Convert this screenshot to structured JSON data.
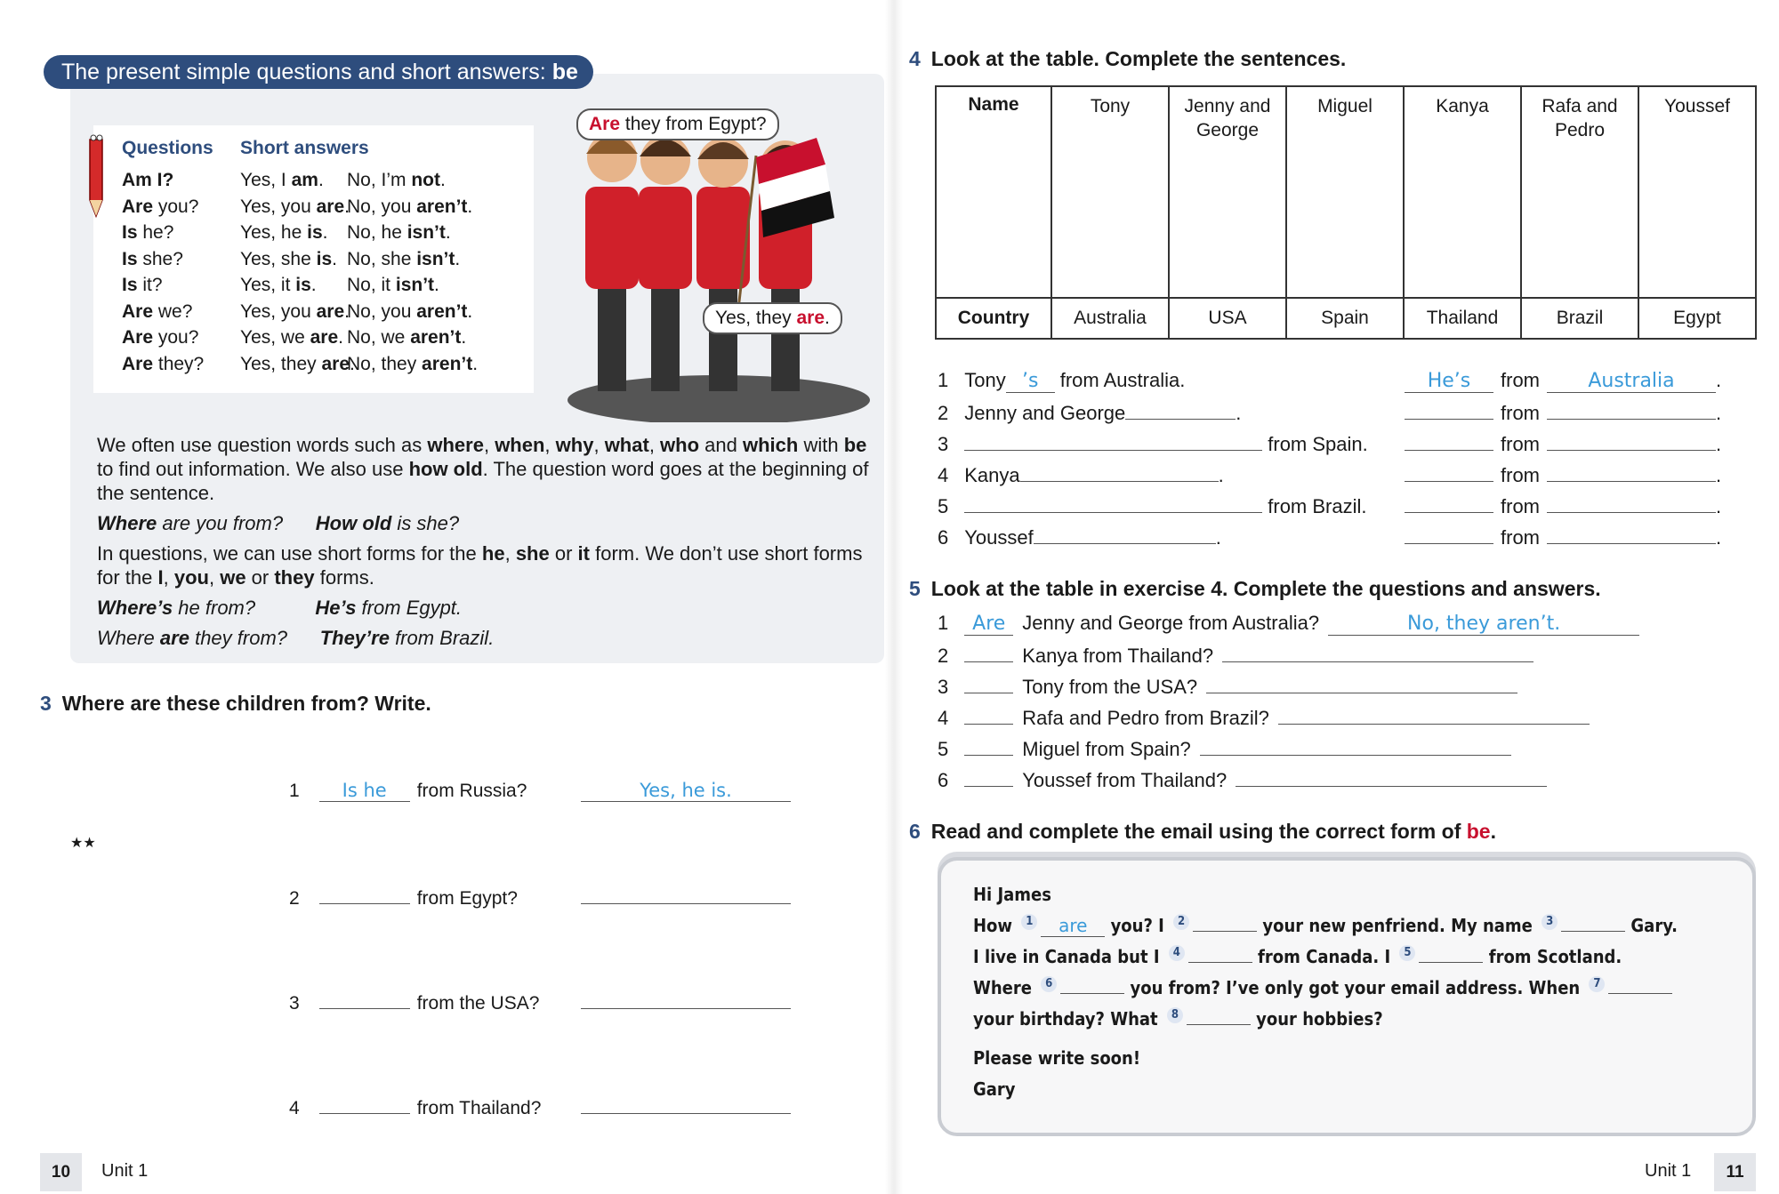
{
  "left_page": {
    "title": [
      {
        "t": "The present simple questions and short answers: "
      },
      {
        "t": "be",
        "s": "b"
      }
    ],
    "qa": {
      "head_q": "Questions",
      "head_a": "Short answers",
      "rows": [
        [
          [
            {
              "t": "Am I?",
              "s": "b"
            }
          ],
          [
            {
              "t": "Yes, I "
            },
            {
              "t": "am",
              "s": "b"
            },
            {
              "t": "."
            }
          ],
          [
            {
              "t": "No, I’m "
            },
            {
              "t": "not",
              "s": "b"
            },
            {
              "t": "."
            }
          ]
        ],
        [
          [
            {
              "t": "Are",
              "s": "b"
            },
            {
              "t": " you?"
            }
          ],
          [
            {
              "t": "Yes, you "
            },
            {
              "t": "are",
              "s": "b"
            },
            {
              "t": "."
            }
          ],
          [
            {
              "t": "No, you "
            },
            {
              "t": "aren’t",
              "s": "b"
            },
            {
              "t": "."
            }
          ]
        ],
        [
          [
            {
              "t": "Is",
              "s": "b"
            },
            {
              "t": " he?"
            }
          ],
          [
            {
              "t": "Yes, he "
            },
            {
              "t": "is",
              "s": "b"
            },
            {
              "t": "."
            }
          ],
          [
            {
              "t": "No, he "
            },
            {
              "t": "isn’t",
              "s": "b"
            },
            {
              "t": "."
            }
          ]
        ],
        [
          [
            {
              "t": "Is",
              "s": "b"
            },
            {
              "t": " she?"
            }
          ],
          [
            {
              "t": "Yes, she "
            },
            {
              "t": "is",
              "s": "b"
            },
            {
              "t": "."
            }
          ],
          [
            {
              "t": "No, she "
            },
            {
              "t": "isn’t",
              "s": "b"
            },
            {
              "t": "."
            }
          ]
        ],
        [
          [
            {
              "t": "Is",
              "s": "b"
            },
            {
              "t": " it?"
            }
          ],
          [
            {
              "t": "Yes, it "
            },
            {
              "t": "is",
              "s": "b"
            },
            {
              "t": "."
            }
          ],
          [
            {
              "t": "No, it "
            },
            {
              "t": "isn’t",
              "s": "b"
            },
            {
              "t": "."
            }
          ]
        ],
        [
          [
            {
              "t": "Are",
              "s": "b"
            },
            {
              "t": " we?"
            }
          ],
          [
            {
              "t": "Yes, you "
            },
            {
              "t": "are",
              "s": "b"
            },
            {
              "t": "."
            }
          ],
          [
            {
              "t": "No, you "
            },
            {
              "t": "aren’t",
              "s": "b"
            },
            {
              "t": "."
            }
          ]
        ],
        [
          [
            {
              "t": "Are",
              "s": "b"
            },
            {
              "t": " you?"
            }
          ],
          [
            {
              "t": "Yes, we "
            },
            {
              "t": "are",
              "s": "b"
            },
            {
              "t": "."
            }
          ],
          [
            {
              "t": "No, we "
            },
            {
              "t": "aren’t",
              "s": "b"
            },
            {
              "t": "."
            }
          ]
        ],
        [
          [
            {
              "t": "Are",
              "s": "b"
            },
            {
              "t": " they?"
            }
          ],
          [
            {
              "t": "Yes, they "
            },
            {
              "t": "are",
              "s": "b"
            },
            {
              "t": "."
            }
          ],
          [
            {
              "t": "No, they "
            },
            {
              "t": "aren’t",
              "s": "b"
            },
            {
              "t": "."
            }
          ]
        ]
      ]
    },
    "bubble_top": [
      {
        "t": "Are",
        "s": "red"
      },
      {
        "t": " they from Egypt?"
      }
    ],
    "bubble_bottom": [
      {
        "t": "Yes, they "
      },
      {
        "t": "are",
        "s": "red"
      },
      {
        "t": "."
      }
    ],
    "paragraphs": [
      [
        {
          "t": "We often use question words such as "
        },
        {
          "t": "where",
          "s": "b"
        },
        {
          "t": ", "
        },
        {
          "t": "when",
          "s": "b"
        },
        {
          "t": ", "
        },
        {
          "t": "why",
          "s": "b"
        },
        {
          "t": ", "
        },
        {
          "t": "what",
          "s": "b"
        },
        {
          "t": ", "
        },
        {
          "t": "who",
          "s": "b"
        },
        {
          "t": " and "
        },
        {
          "t": "which",
          "s": "b"
        },
        {
          "t": " with "
        },
        {
          "t": "be",
          "s": "b"
        },
        {
          "t": " to find out information. We also use "
        },
        {
          "t": "how old",
          "s": "b"
        },
        {
          "t": ". The question word goes at the beginning of the sentence."
        }
      ],
      [
        {
          "t": "Where",
          "s": "bi"
        },
        {
          "t": " are you from?      ",
          "s": "i"
        },
        {
          "t": "How old",
          "s": "bi"
        },
        {
          "t": " is she?",
          "s": "i"
        }
      ],
      [
        {
          "t": "In questions, we can use short forms for the "
        },
        {
          "t": "he",
          "s": "b"
        },
        {
          "t": ", "
        },
        {
          "t": "she",
          "s": "b"
        },
        {
          "t": " or "
        },
        {
          "t": "it",
          "s": "b"
        },
        {
          "t": " form. We don’t use short forms for the "
        },
        {
          "t": "I",
          "s": "b"
        },
        {
          "t": ", "
        },
        {
          "t": "you",
          "s": "b"
        },
        {
          "t": ", "
        },
        {
          "t": "we",
          "s": "b"
        },
        {
          "t": " or "
        },
        {
          "t": "they",
          "s": "b"
        },
        {
          "t": " forms."
        }
      ],
      [
        {
          "t": "Where’s",
          "s": "bi"
        },
        {
          "t": " he from?           ",
          "s": "i"
        },
        {
          "t": "He’s",
          "s": "bi"
        },
        {
          "t": " from Egypt.",
          "s": "i"
        }
      ],
      [
        {
          "t": "Where ",
          "s": "i"
        },
        {
          "t": "are",
          "s": "bi"
        },
        {
          "t": " they from?      ",
          "s": "i"
        },
        {
          "t": "They’re",
          "s": "bi"
        },
        {
          "t": " from Brazil.",
          "s": "i"
        }
      ]
    ],
    "ex3": {
      "num": "3",
      "title": "Where are these children from? Write.",
      "flags": [
        "russia",
        "australia",
        "usa",
        "uk"
      ],
      "items": [
        {
          "n": "1",
          "ans": "Is he",
          "text": "from Russia?",
          "reply": "Yes, he is."
        },
        {
          "n": "2",
          "ans": "",
          "text": "from Egypt?",
          "reply": ""
        },
        {
          "n": "3",
          "ans": "",
          "text": "from the USA?",
          "reply": ""
        },
        {
          "n": "4",
          "ans": "",
          "text": "from Thailand?",
          "reply": ""
        }
      ]
    },
    "page_number": "10",
    "unit": "Unit 1"
  },
  "right_page": {
    "ex4": {
      "num": "4",
      "title": "Look at the table. Complete the sentences.",
      "name_label": "Name",
      "country_label": "Country",
      "people": [
        {
          "name": "Tony",
          "country": "Australia"
        },
        {
          "name": "Jenny and George",
          "country": "USA"
        },
        {
          "name": "Miguel",
          "country": "Spain"
        },
        {
          "name": "Kanya",
          "country": "Thailand"
        },
        {
          "name": "Rafa and Pedro",
          "country": "Brazil"
        },
        {
          "name": "Youssef",
          "country": "Egypt"
        }
      ],
      "sentences": [
        {
          "n": "1",
          "pre": "Tony",
          "blank": "’s",
          "post": "from Australia.",
          "a1": "He’s",
          "from": "from",
          "a2": "Australia"
        },
        {
          "n": "2",
          "pre": "Jenny and George",
          "blank": "",
          "post": ".",
          "a1": "",
          "from": "from",
          "a2": ""
        },
        {
          "n": "3",
          "pre": "",
          "blank": "",
          "post": "from Spain.",
          "a1": "",
          "from": "from",
          "a2": ""
        },
        {
          "n": "4",
          "pre": "Kanya",
          "blank": "",
          "post": ".",
          "a1": "",
          "from": "from",
          "a2": ""
        },
        {
          "n": "5",
          "pre": "",
          "blank": "",
          "post": "from Brazil.",
          "a1": "",
          "from": "from",
          "a2": ""
        },
        {
          "n": "6",
          "pre": "Youssef",
          "blank": "",
          "post": ".",
          "a1": "",
          "from": "from",
          "a2": ""
        }
      ]
    },
    "ex5": {
      "num": "5",
      "title": "Look at the table in exercise 4. Complete the questions and answers.",
      "items": [
        {
          "n": "1",
          "ans": "Are",
          "text": "Jenny and George from Australia?",
          "reply": "No, they aren’t."
        },
        {
          "n": "2",
          "ans": "",
          "text": "Kanya from Thailand?",
          "reply": ""
        },
        {
          "n": "3",
          "ans": "",
          "text": "Tony from the USA?",
          "reply": ""
        },
        {
          "n": "4",
          "ans": "",
          "text": "Rafa and Pedro from Brazil?",
          "reply": ""
        },
        {
          "n": "5",
          "ans": "",
          "text": "Miguel from Spain?",
          "reply": ""
        },
        {
          "n": "6",
          "ans": "",
          "text": "Youssef from Thailand?",
          "reply": ""
        }
      ]
    },
    "ex6": {
      "num": "6",
      "title": "Read and complete the email using the correct form of ",
      "title_red": "be",
      "title_end": ".",
      "email": [
        [
          {
            "t": "Hi James"
          }
        ],
        [
          {
            "t": "How "
          },
          {
            "c": "1",
            "a": "are"
          },
          {
            "t": " you? I "
          },
          {
            "c": "2",
            "a": ""
          },
          {
            "t": " your new penfriend. My name "
          },
          {
            "c": "3",
            "a": ""
          },
          {
            "t": " Gary."
          }
        ],
        [
          {
            "t": "I live in Canada but I "
          },
          {
            "c": "4",
            "a": ""
          },
          {
            "t": " from Canada. I "
          },
          {
            "c": "5",
            "a": ""
          },
          {
            "t": " from Scotland."
          }
        ],
        [
          {
            "t": "Where "
          },
          {
            "c": "6",
            "a": ""
          },
          {
            "t": " you from? I’ve only got your email address. When "
          },
          {
            "c": "7",
            "a": ""
          }
        ],
        [
          {
            "t": "your birthday? What "
          },
          {
            "c": "8",
            "a": ""
          },
          {
            "t": " your hobbies?"
          }
        ],
        [
          {
            "t": "Please write soon!"
          }
        ],
        [
          {
            "t": "Gary"
          }
        ]
      ]
    },
    "page_number": "11",
    "unit": "Unit 1"
  },
  "colors": {
    "heading_blue": "#2e4d7d",
    "red": "#c8102e",
    "handwriting": "#3a9ad9"
  }
}
